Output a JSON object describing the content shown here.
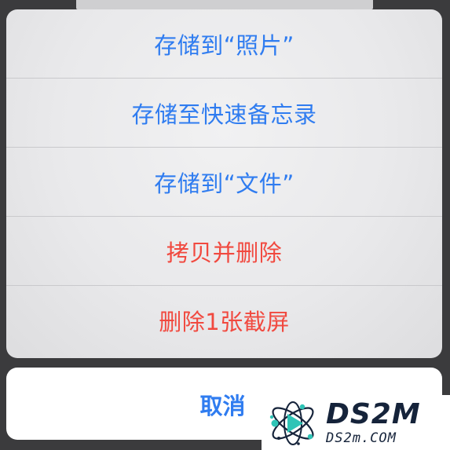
{
  "action_sheet": {
    "actions": [
      {
        "label": "存储到“照片”",
        "style": "default"
      },
      {
        "label": "存储至快速备忘录",
        "style": "default"
      },
      {
        "label": "存储到“文件”",
        "style": "default"
      },
      {
        "label": "拷贝并删除",
        "style": "destructive"
      },
      {
        "label": "删除1张截屏",
        "style": "destructive"
      }
    ],
    "cancel_label": "取消"
  },
  "watermark": {
    "title": "DS2M",
    "subtitle": "DS2m.COM",
    "icon": "atom-play-logo-icon"
  },
  "colors": {
    "accent": "#2f7cf0",
    "destructive": "#f1493f",
    "sheet_background": "#ececee",
    "separator": "#c9c9cc",
    "cancel_background": "#ffffff",
    "dim_background": "#3b3b3d",
    "watermark_dark": "#15233a",
    "watermark_teal": "#2ec4b6"
  }
}
